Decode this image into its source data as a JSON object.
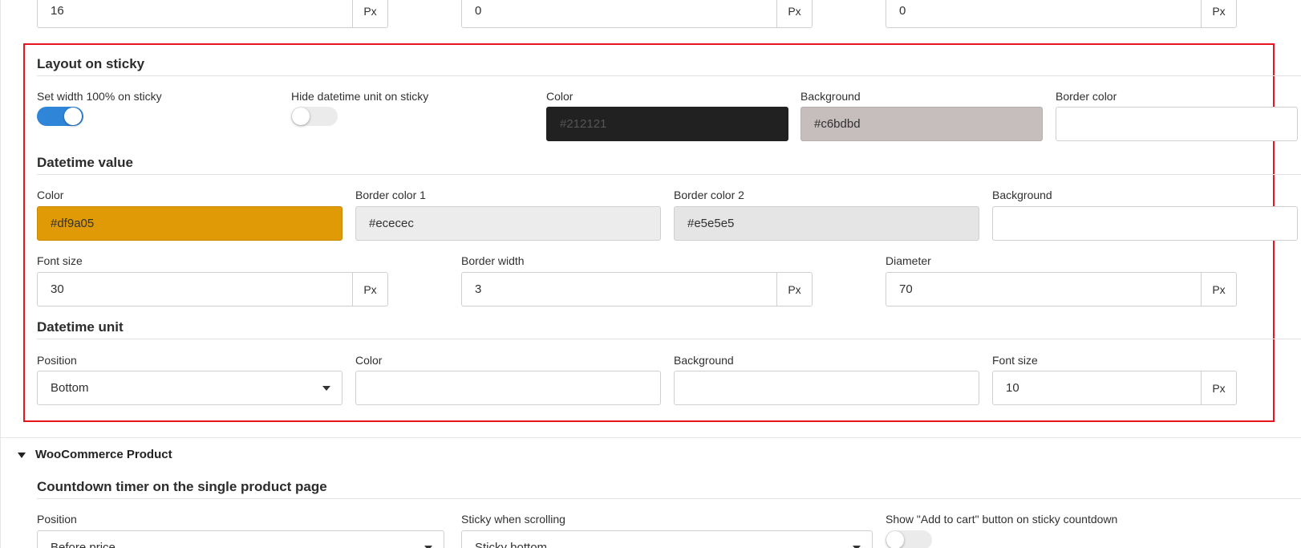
{
  "top_row": {
    "field1_value": "16",
    "field2_value": "0",
    "field3_value": "0",
    "unit": "Px"
  },
  "layout_on_sticky": {
    "title": "Layout on sticky",
    "set_width_label": "Set width 100% on sticky",
    "set_width_on": true,
    "hide_unit_label": "Hide datetime unit on sticky",
    "hide_unit_on": false,
    "color_label": "Color",
    "color_value": "#212121",
    "background_label": "Background",
    "background_value": "#c6bdbd",
    "border_color_label": "Border color",
    "border_color_value": ""
  },
  "datetime_value": {
    "title": "Datetime value",
    "color_label": "Color",
    "color_value": "#df9a05",
    "border_color1_label": "Border color 1",
    "border_color1_value": "#ececec",
    "border_color2_label": "Border color 2",
    "border_color2_value": "#e5e5e5",
    "background_label": "Background",
    "background_value": "",
    "font_size_label": "Font size",
    "font_size_value": "30",
    "border_width_label": "Border width",
    "border_width_value": "3",
    "diameter_label": "Diameter",
    "diameter_value": "70",
    "unit": "Px"
  },
  "datetime_unit": {
    "title": "Datetime unit",
    "position_label": "Position",
    "position_value": "Bottom",
    "color_label": "Color",
    "color_value": "",
    "background_label": "Background",
    "background_value": "",
    "font_size_label": "Font size",
    "font_size_value": "10",
    "unit": "Px"
  },
  "woocommerce": {
    "title": "WooCommerce Product",
    "subtitle": "Countdown timer on the single product page",
    "position_label": "Position",
    "position_value": "Before price",
    "sticky_label": "Sticky when scrolling",
    "sticky_value": "Sticky bottom",
    "add_to_cart_label": "Show \"Add to cart\" button on sticky countdown",
    "add_to_cart_on": false
  },
  "colors": {
    "highlight_border": "#e8141e",
    "toggle_on": "#2f86d9",
    "sticky_color_swatch": "#212121",
    "sticky_bg_swatch": "#c6bdbd",
    "value_color_swatch": "#df9a05",
    "border1_swatch": "#ececec",
    "border2_swatch": "#e5e5e5"
  }
}
